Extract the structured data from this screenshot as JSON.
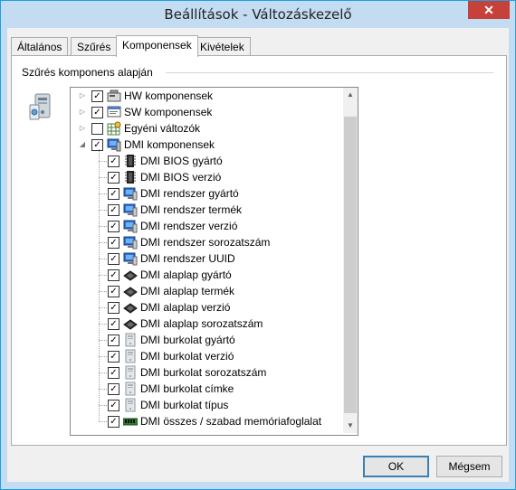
{
  "window": {
    "title": "Beállítások - Változáskezelő",
    "close_glyph": "✕"
  },
  "tabs": [
    "Általános",
    "Szűrés",
    "Komponensek",
    "Kivételek"
  ],
  "active_tab": 2,
  "panel": {
    "group_label": "Szűrés komponens alapján"
  },
  "tree": [
    {
      "label": "HW komponensek",
      "level": 0,
      "checked": true,
      "expander": "▷",
      "icon": "hardware-icon"
    },
    {
      "label": "SW komponensek",
      "level": 0,
      "checked": true,
      "expander": "▷",
      "icon": "software-icon"
    },
    {
      "label": "Egyéni változók",
      "level": 0,
      "checked": false,
      "expander": "▷",
      "icon": "custom-variables-icon"
    },
    {
      "label": "DMI komponensek",
      "level": 0,
      "checked": true,
      "expander": "◢",
      "icon": "dmi-icon"
    },
    {
      "label": "DMI BIOS gyártó",
      "level": 1,
      "checked": true,
      "icon": "bios-chip-icon"
    },
    {
      "label": "DMI BIOS verzió",
      "level": 1,
      "checked": true,
      "icon": "bios-chip-icon"
    },
    {
      "label": "DMI rendszer gyártó",
      "level": 1,
      "checked": true,
      "icon": "computer-icon"
    },
    {
      "label": "DMI rendszer termék",
      "level": 1,
      "checked": true,
      "icon": "computer-icon"
    },
    {
      "label": "DMI rendszer verzió",
      "level": 1,
      "checked": true,
      "icon": "computer-icon"
    },
    {
      "label": "DMI rendszer sorozatszám",
      "level": 1,
      "checked": true,
      "icon": "computer-icon"
    },
    {
      "label": "DMI rendszer UUID",
      "level": 1,
      "checked": true,
      "icon": "computer-icon"
    },
    {
      "label": "DMI alaplap gyártó",
      "level": 1,
      "checked": true,
      "icon": "motherboard-icon"
    },
    {
      "label": "DMI alaplap termék",
      "level": 1,
      "checked": true,
      "icon": "motherboard-icon"
    },
    {
      "label": "DMI alaplap verzió",
      "level": 1,
      "checked": true,
      "icon": "motherboard-icon"
    },
    {
      "label": "DMI alaplap sorozatszám",
      "level": 1,
      "checked": true,
      "icon": "motherboard-icon"
    },
    {
      "label": "DMI burkolat gyártó",
      "level": 1,
      "checked": true,
      "icon": "chassis-icon"
    },
    {
      "label": "DMI burkolat verzió",
      "level": 1,
      "checked": true,
      "icon": "chassis-icon"
    },
    {
      "label": "DMI burkolat sorozatszám",
      "level": 1,
      "checked": true,
      "icon": "chassis-icon"
    },
    {
      "label": "DMI burkolat címke",
      "level": 1,
      "checked": true,
      "icon": "chassis-icon"
    },
    {
      "label": "DMI burkolat típus",
      "level": 1,
      "checked": true,
      "icon": "chassis-icon"
    },
    {
      "label": "DMI összes / szabad memóriafoglalat",
      "level": 1,
      "checked": true,
      "icon": "memory-slot-icon"
    }
  ],
  "scrollbar": {
    "up_glyph": "▲",
    "down_glyph": "▼"
  },
  "buttons": {
    "ok": "OK",
    "cancel": "Mégsem"
  },
  "colors": {
    "accent": "#1ba1e2",
    "title_bg": "#c3dcf2",
    "close_bg": "#c7413b"
  }
}
